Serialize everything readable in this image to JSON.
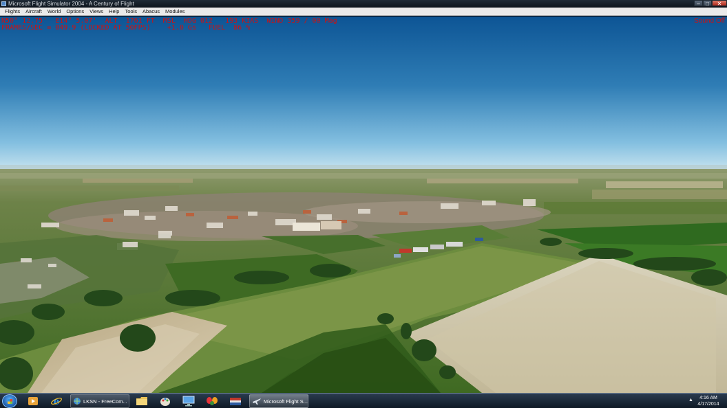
{
  "window": {
    "title": "Microsoft Flight Simulator 2004 - A Century of Flight",
    "controls": [
      "minimize",
      "maximize",
      "close"
    ]
  },
  "menu": {
    "items": [
      {
        "label": "Flights"
      },
      {
        "label": "Aircraft"
      },
      {
        "label": "World"
      },
      {
        "label": "Options"
      },
      {
        "label": "Views"
      },
      {
        "label": "Help"
      },
      {
        "label": "Tools"
      },
      {
        "label": "Abacus"
      },
      {
        "label": "Modules"
      }
    ]
  },
  "hud": {
    "line1": "N50° 12.75'  E14° 5.07'  ALT  1761 FT  MSL  HDG 012   193 KIAS  WIND 359 / 00 Mag",
    "line2": "FRAMES/SEC = 049.9 (LOCKED AT 50FPS)    +1.0 Gs   FUEL  86 %",
    "sound": "Sound Off",
    "color": "#d11010"
  },
  "scene": {
    "sky_top": "#0f5a9c",
    "sky_horizon": "#b9dcef",
    "field_green": "#4f7a2a",
    "field_tan": "#c9b991"
  },
  "taskbar": {
    "pinned": [
      {
        "icon": "media-player-icon"
      },
      {
        "icon": "internet-explorer-icon"
      }
    ],
    "tasks": [
      {
        "label": "LKSN - FreeCom...",
        "icon": "globe-icon",
        "active": false
      },
      {
        "label": "Microsoft Flight S...",
        "icon": "airplane-icon",
        "active": true
      }
    ],
    "apps": [
      {
        "icon": "folder-icon"
      },
      {
        "icon": "paint-icon"
      },
      {
        "icon": "monitor-icon"
      },
      {
        "icon": "butterfly-icon"
      },
      {
        "icon": "flag-icon"
      }
    ],
    "clock": {
      "time": "4:16 AM",
      "date": "4/17/2014"
    }
  }
}
